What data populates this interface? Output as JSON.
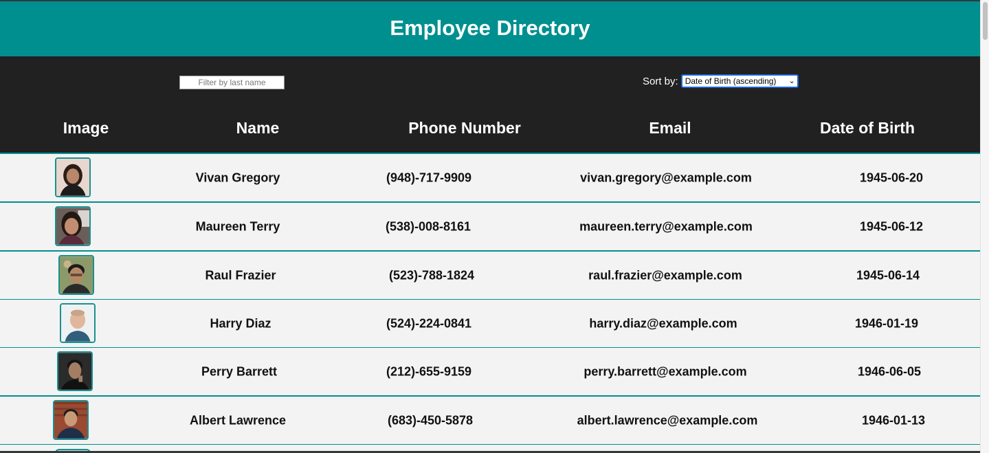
{
  "header": {
    "title": "Employee Directory"
  },
  "controls": {
    "filter_placeholder": "Filter by last name",
    "sort_label": "Sort by:",
    "sort_selected": "Date of Birth (ascending)"
  },
  "table": {
    "columns": [
      "Image",
      "Name",
      "Phone Number",
      "Email",
      "Date of Birth"
    ],
    "rows": [
      {
        "name": "Vivan Gregory",
        "phone": "(948)-717-9909",
        "email": "vivan.gregory@example.com",
        "dob": "1945-06-20"
      },
      {
        "name": "Maureen Terry",
        "phone": "(538)-008-8161",
        "email": "maureen.terry@example.com",
        "dob": "1945-06-12"
      },
      {
        "name": "Raul Frazier",
        "phone": "(523)-788-1824",
        "email": "raul.frazier@example.com",
        "dob": "1945-06-14"
      },
      {
        "name": "Harry Diaz",
        "phone": "(524)-224-0841",
        "email": "harry.diaz@example.com",
        "dob": "1946-01-19"
      },
      {
        "name": "Perry Barrett",
        "phone": "(212)-655-9159",
        "email": "perry.barrett@example.com",
        "dob": "1946-06-05"
      },
      {
        "name": "Albert Lawrence",
        "phone": "(683)-450-5878",
        "email": "albert.lawrence@example.com",
        "dob": "1946-01-13"
      }
    ]
  },
  "colors": {
    "accent": "#008f8f",
    "dark_bar": "#212121",
    "row_bg": "#f3f3f3"
  }
}
